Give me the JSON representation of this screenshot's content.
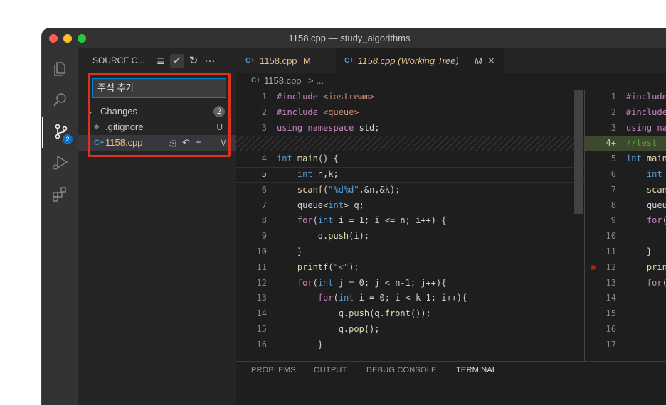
{
  "window": {
    "title": "1158.cpp — study_algorithms",
    "colors": {
      "close": "#ff5f57",
      "minimize": "#febc2e",
      "zoom": "#28c840",
      "accent": "#0e70c0",
      "highlight_box": "#e0301e"
    }
  },
  "activity_bar": {
    "items": [
      {
        "name": "explorer",
        "icon": "files-icon"
      },
      {
        "name": "search",
        "icon": "search-icon"
      },
      {
        "name": "source-control",
        "icon": "source-control-icon",
        "badge": "2"
      },
      {
        "name": "run-debug",
        "icon": "debug-icon"
      },
      {
        "name": "extensions",
        "icon": "extensions-icon"
      }
    ]
  },
  "sidebar": {
    "title": "SOURCE C...",
    "commit_message": "주석 추가",
    "changes_label": "Changes",
    "changes_count": "2",
    "files": [
      {
        "name": ".gitignore",
        "status": "U"
      },
      {
        "name": "1158.cpp",
        "status": "M"
      }
    ]
  },
  "tabs": [
    {
      "icon": "C+",
      "label": "1158.cpp",
      "badge": "M"
    },
    {
      "icon": "C+",
      "label": "1158.cpp (Working Tree)",
      "badge": "M",
      "close": "×"
    }
  ],
  "breadcrumb": {
    "file": "1158.cpp",
    "rest": "> ..."
  },
  "left_lines": [
    "1",
    "2",
    "3",
    "4",
    "5",
    "6",
    "7",
    "8",
    "9",
    "10",
    "11",
    "12",
    "13",
    "14",
    "15",
    "16"
  ],
  "right_lines": [
    "1",
    "2",
    "3",
    "4+",
    "5",
    "6",
    "7",
    "8",
    "9",
    "10",
    "11",
    "12",
    "13",
    "14",
    "15",
    "16",
    "17"
  ],
  "panel_tabs": [
    "PROBLEMS",
    "OUTPUT",
    "DEBUG CONSOLE",
    "TERMINAL"
  ]
}
